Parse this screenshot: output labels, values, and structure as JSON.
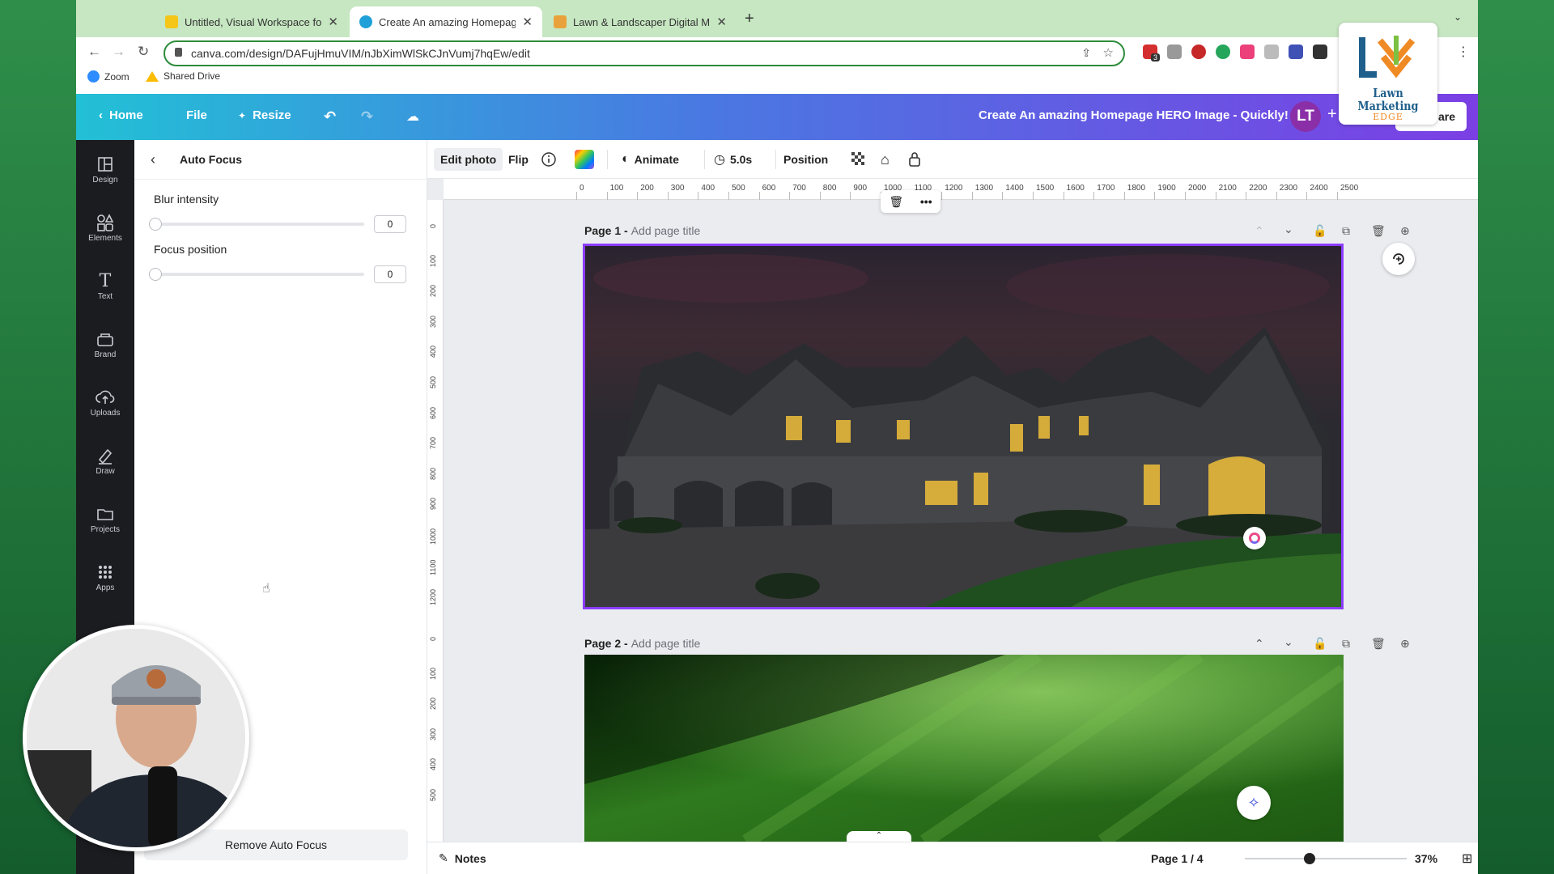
{
  "browser": {
    "tabs": [
      {
        "title": "Untitled, Visual Workspace for",
        "active": false
      },
      {
        "title": "Create An amazing Homepage",
        "active": true
      },
      {
        "title": "Lawn & Landscaper Digital Ma",
        "active": false
      }
    ],
    "url": "canva.com/design/DAFujHmuVIM/nJbXimWlSkCJnVumj7hqEw/edit",
    "bookmarks": [
      {
        "label": "Zoom"
      },
      {
        "label": "Shared Drive"
      }
    ],
    "extension_badge": "3"
  },
  "header": {
    "home": "Home",
    "file": "File",
    "resize": "Resize",
    "design_title": "Create An amazing Homepage HERO Image - Quickly!",
    "avatar": "LT",
    "share": "are"
  },
  "logo": {
    "line1": "Lawn Marketing",
    "line2": "EDGE"
  },
  "sidebar": {
    "items": [
      {
        "label": "Design"
      },
      {
        "label": "Elements"
      },
      {
        "label": "Text"
      },
      {
        "label": "Brand"
      },
      {
        "label": "Uploads"
      },
      {
        "label": "Draw"
      },
      {
        "label": "Projects"
      },
      {
        "label": "Apps"
      }
    ]
  },
  "panel": {
    "title": "Auto Focus",
    "blur_label": "Blur intensity",
    "blur_value": "0",
    "focus_label": "Focus position",
    "focus_value": "0",
    "remove_button": "Remove Auto Focus"
  },
  "toolbar": {
    "edit_photo": "Edit photo",
    "flip": "Flip",
    "animate": "Animate",
    "duration": "5.0s",
    "position": "Position"
  },
  "ruler": {
    "h_ticks": [
      "0",
      "100",
      "200",
      "300",
      "400",
      "500",
      "600",
      "700",
      "800",
      "900",
      "1000",
      "1100",
      "1200",
      "1300",
      "1400",
      "1500",
      "1600",
      "1700",
      "1800",
      "1900",
      "2000",
      "2100",
      "2200",
      "2300",
      "2400",
      "2500"
    ],
    "v_ticks_p1": [
      "0",
      "100",
      "200",
      "300",
      "400",
      "500",
      "600",
      "700",
      "800",
      "900",
      "1000",
      "1100",
      "1200"
    ],
    "v_ticks_p2": [
      "0",
      "100",
      "200",
      "300",
      "400",
      "500"
    ]
  },
  "pages": [
    {
      "label": "Page 1 -",
      "placeholder": "Add page title"
    },
    {
      "label": "Page 2 -",
      "placeholder": "Add page title"
    }
  ],
  "footer": {
    "notes": "Notes",
    "page_indicator": "Page 1 / 4",
    "zoom_percent": "37%",
    "zoom_slider_value": 0.4
  },
  "colors": {
    "accent_purple": "#8b3dff",
    "header_gradient_start": "#22c0d6",
    "header_gradient_end": "#7b3fe4",
    "tab_strip": "#c6e7c1"
  }
}
